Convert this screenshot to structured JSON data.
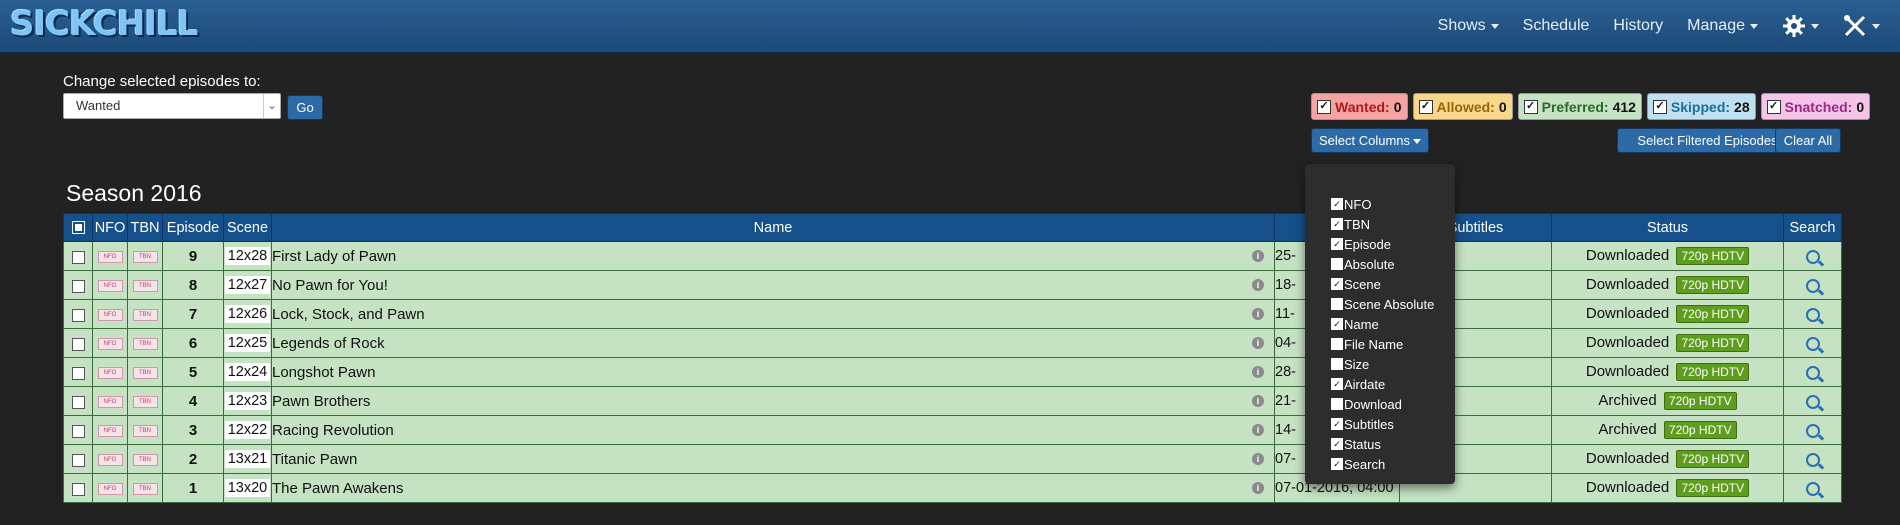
{
  "app": {
    "logo": "SICKCHILL"
  },
  "nav": {
    "items": [
      {
        "label": "Shows",
        "dropdown": true
      },
      {
        "label": "Schedule",
        "dropdown": false
      },
      {
        "label": "History",
        "dropdown": false
      },
      {
        "label": "Manage",
        "dropdown": true
      }
    ],
    "settings_icon": "gear-icon",
    "tools_icon": "tools-icon"
  },
  "controls": {
    "change_label": "Change selected episodes to:",
    "status_select_value": "Wanted",
    "go_label": "Go",
    "select_columns_label": "Select Columns",
    "select_filtered_label": "Select Filtered Episodes",
    "clear_all_label": "Clear All"
  },
  "badges": [
    {
      "label": "Wanted:",
      "count": "0",
      "bg": "#f5a3a3",
      "color": "#b01818",
      "checked": true
    },
    {
      "label": "Allowed:",
      "count": "0",
      "bg": "#f7d88a",
      "color": "#9a6408",
      "checked": true
    },
    {
      "label": "Preferred:",
      "count": "412",
      "bg": "#c5e2c3",
      "color": "#2a6a2a",
      "checked": true
    },
    {
      "label": "Skipped:",
      "count": "28",
      "bg": "#bfe0f1",
      "color": "#1d6e9c",
      "checked": true
    },
    {
      "label": "Snatched:",
      "count": "0",
      "bg": "#f4c5e8",
      "color": "#9a2a82",
      "checked": true
    }
  ],
  "season": {
    "title": "Season 2016"
  },
  "table": {
    "headers": {
      "nfo": "NFO",
      "tbn": "TBN",
      "episode": "Episode",
      "scene": "Scene",
      "name": "Name",
      "subtitles": "Subtitles",
      "status": "Status",
      "search": "Search"
    },
    "rows": [
      {
        "episode": "9",
        "scene": "12x28",
        "name": "First Lady of Pawn",
        "airdate": "25-",
        "status": "Downloaded",
        "quality": "720p HDTV"
      },
      {
        "episode": "8",
        "scene": "12x27",
        "name": "No Pawn for You!",
        "airdate": "18-",
        "status": "Downloaded",
        "quality": "720p HDTV"
      },
      {
        "episode": "7",
        "scene": "12x26",
        "name": "Lock, Stock, and Pawn",
        "airdate": "11-",
        "status": "Downloaded",
        "quality": "720p HDTV"
      },
      {
        "episode": "6",
        "scene": "12x25",
        "name": "Legends of Rock",
        "airdate": "04-",
        "status": "Downloaded",
        "quality": "720p HDTV"
      },
      {
        "episode": "5",
        "scene": "12x24",
        "name": "Longshot Pawn",
        "airdate": "28-",
        "status": "Downloaded",
        "quality": "720p HDTV"
      },
      {
        "episode": "4",
        "scene": "12x23",
        "name": "Pawn Brothers",
        "airdate": "21-",
        "status": "Archived",
        "quality": "720p HDTV"
      },
      {
        "episode": "3",
        "scene": "12x22",
        "name": "Racing Revolution",
        "airdate": "14-",
        "status": "Archived",
        "quality": "720p HDTV"
      },
      {
        "episode": "2",
        "scene": "13x21",
        "name": "Titanic Pawn",
        "airdate": "07-",
        "status": "Downloaded",
        "quality": "720p HDTV"
      },
      {
        "episode": "1",
        "scene": "13x20",
        "name": "The Pawn Awakens",
        "airdate": "07-01-2016, 04:00",
        "status": "Downloaded",
        "quality": "720p HDTV"
      }
    ]
  },
  "column_menu": [
    {
      "label": "NFO",
      "checked": true
    },
    {
      "label": "TBN",
      "checked": true
    },
    {
      "label": "Episode",
      "checked": true
    },
    {
      "label": "Absolute",
      "checked": false
    },
    {
      "label": "Scene",
      "checked": true
    },
    {
      "label": "Scene Absolute",
      "checked": false
    },
    {
      "label": "Name",
      "checked": true
    },
    {
      "label": "File Name",
      "checked": false
    },
    {
      "label": "Size",
      "checked": false
    },
    {
      "label": "Airdate",
      "checked": true
    },
    {
      "label": "Download",
      "checked": false
    },
    {
      "label": "Subtitles",
      "checked": true
    },
    {
      "label": "Status",
      "checked": true
    },
    {
      "label": "Search",
      "checked": true
    }
  ]
}
